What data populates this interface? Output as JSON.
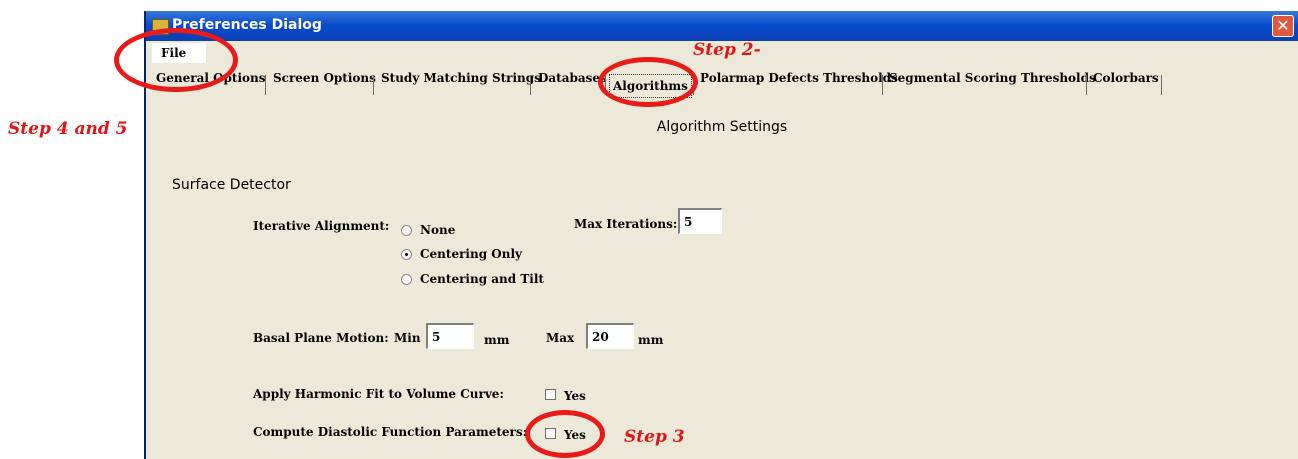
{
  "window": {
    "title": "Preferences Dialog",
    "close_glyph": "✕"
  },
  "menu": {
    "file": "File"
  },
  "tabs": [
    "General Options",
    "Screen Options",
    "Study Matching Strings",
    "Databases",
    "Algorithms",
    "Polarmap Defects Thresholds",
    "Segmental Scoring Thresholds",
    "Colorbars"
  ],
  "active_tab": "Algorithms",
  "content": {
    "section_title": "Algorithm Settings",
    "surface_detector": "Surface Detector",
    "iterative_alignment": {
      "label": "Iterative Alignment:",
      "options": [
        "None",
        "Centering Only",
        "Centering and Tilt"
      ],
      "selected": "Centering Only",
      "max_iterations_label": "Max Iterations:",
      "max_iterations_value": "5"
    },
    "basal_plane_motion": {
      "label": "Basal Plane Motion:",
      "min_label": "Min",
      "min_value": "5",
      "max_label": "Max",
      "max_value": "20",
      "unit": "mm"
    },
    "harmonic_fit": {
      "label": "Apply Harmonic Fit to Volume Curve:",
      "option": "Yes",
      "checked": false
    },
    "diastolic": {
      "label": "Compute Diastolic Function Parameters:",
      "option": "Yes",
      "checked": false
    }
  },
  "annotations": {
    "step2": "Step 2-",
    "step3": "Step 3",
    "step45": "Step 4 and 5",
    "color": "#e31414"
  }
}
